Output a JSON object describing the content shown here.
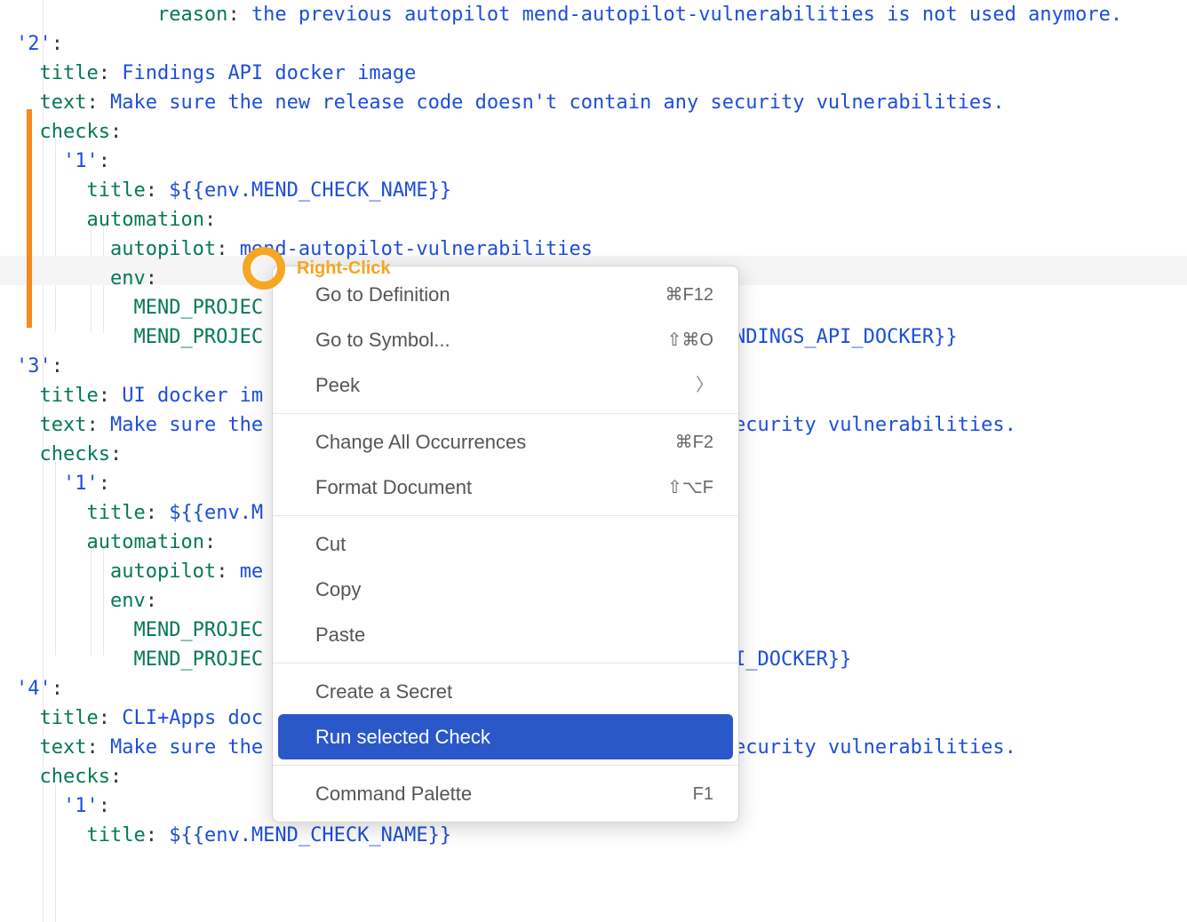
{
  "annotation": {
    "label": "Right-Click"
  },
  "code": {
    "lines": [
      {
        "indent": 6,
        "key": "reason",
        "val": "the previous autopilot mend-autopilot-vulnerabilities is not used anymore."
      },
      {
        "indent": 0,
        "key": "'2'",
        "val": ""
      },
      {
        "indent": 2,
        "key": "title",
        "val": "Findings API docker image"
      },
      {
        "indent": 2,
        "key": "text",
        "val": "Make sure the new release code doesn't contain any security vulnerabilities."
      },
      {
        "indent": 2,
        "key": "checks",
        "val": ""
      },
      {
        "indent": 3,
        "key": "'1'",
        "val": ""
      },
      {
        "indent": 4,
        "key": "title",
        "val": "${{env.MEND_CHECK_NAME}}"
      },
      {
        "indent": 4,
        "key": "automation",
        "val": ""
      },
      {
        "indent": 5,
        "key": "autopilot",
        "val": "mend-autopilot-vulnerabilities"
      },
      {
        "indent": 5,
        "key": "env",
        "val": ""
      },
      {
        "indent": 6,
        "key": "MEND_PROJEC",
        "val": ""
      },
      {
        "indent": 6,
        "key": "MEND_PROJEC",
        "val_tail": "INDINGS_API_DOCKER}}"
      },
      {
        "indent": 0,
        "key": "'3'",
        "val": ""
      },
      {
        "indent": 2,
        "key": "title",
        "val": "UI docker im"
      },
      {
        "indent": 2,
        "key": "text",
        "val_pre": "Make sure the",
        "val_tail": "ecurity vulnerabilities."
      },
      {
        "indent": 2,
        "key": "checks",
        "val": ""
      },
      {
        "indent": 3,
        "key": "'1'",
        "val": ""
      },
      {
        "indent": 4,
        "key": "title",
        "val_pre": "${{env.M"
      },
      {
        "indent": 4,
        "key": "automation",
        "val": ""
      },
      {
        "indent": 5,
        "key": "autopilot",
        "val_pre": "me"
      },
      {
        "indent": 5,
        "key": "env",
        "val": ""
      },
      {
        "indent": 6,
        "key": "MEND_PROJEC",
        "val": ""
      },
      {
        "indent": 6,
        "key": "MEND_PROJEC",
        "val_tail": "UI_DOCKER}}"
      },
      {
        "indent": 0,
        "key": "'4'",
        "val": ""
      },
      {
        "indent": 2,
        "key": "title",
        "val_pre": "CLI+Apps doc"
      },
      {
        "indent": 2,
        "key": "text",
        "val_pre": "Make sure the",
        "val_tail": "ecurity vulnerabilities."
      },
      {
        "indent": 2,
        "key": "checks",
        "val": ""
      },
      {
        "indent": 3,
        "key": "'1'",
        "val": ""
      },
      {
        "indent": 4,
        "key": "title",
        "val": "${{env.MEND_CHECK_NAME}}"
      }
    ]
  },
  "menu": {
    "groups": [
      [
        {
          "label": "Go to Definition",
          "shortcut": "⌘F12"
        },
        {
          "label": "Go to Symbol...",
          "shortcut": "⇧⌘O"
        },
        {
          "label": "Peek",
          "submenu": true
        }
      ],
      [
        {
          "label": "Change All Occurrences",
          "shortcut": "⌘F2"
        },
        {
          "label": "Format Document",
          "shortcut": "⇧⌥F"
        }
      ],
      [
        {
          "label": "Cut"
        },
        {
          "label": "Copy"
        },
        {
          "label": "Paste"
        }
      ],
      [
        {
          "label": "Create a Secret"
        },
        {
          "label": "Run selected Check",
          "highlighted": true
        }
      ],
      [
        {
          "label": "Command Palette",
          "shortcut": "F1"
        }
      ]
    ]
  }
}
